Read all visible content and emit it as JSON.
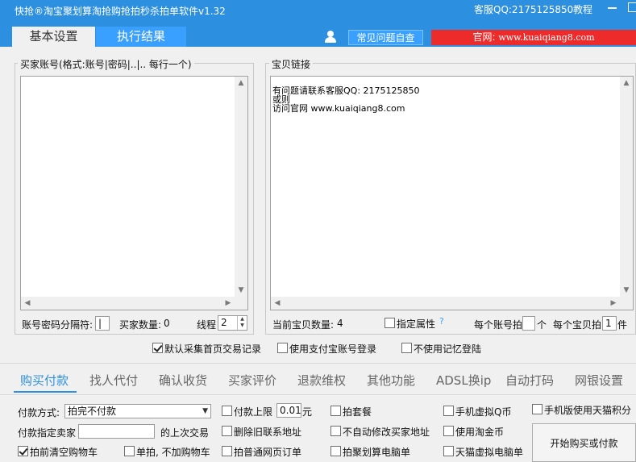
{
  "app": {
    "title": "快抢®淘宝聚划算淘抢购抢拍秒杀拍单软件v1.32",
    "qq": "客服QQ:2175125850",
    "tutorial": "教程"
  },
  "tabs": {
    "basic": "基本设置",
    "result": "执行结果"
  },
  "header": {
    "faq_button": "常见问题自查",
    "site_prefix": "官网: ",
    "site_url": "www.kuaiqiang8.com"
  },
  "buyer_accounts": {
    "group_label": "买家账号(格式:账号|密码|..|.. 每行一个)",
    "content": ""
  },
  "item_links": {
    "group_label": "宝贝链接",
    "lines": [
      "有问题请联系客服QQ: 2175125850",
      "或则",
      "访问官网 www.kuaiqiang8.com"
    ]
  },
  "account_row": {
    "separator_label": "账号密码分隔符:",
    "separator_value": "|",
    "buyer_count_label": "买家数量:",
    "buyer_count": "0",
    "threads_label": "线程",
    "threads_value": "2"
  },
  "item_row": {
    "item_count_label": "当前宝贝数量:",
    "item_count": "4",
    "specify_attr_label": "指定属性",
    "help_icon_text": "?",
    "per_account_label_a": "每个账号拍",
    "per_account_value": "",
    "per_account_label_b": "个",
    "per_item_label_a": "每个宝贝拍",
    "per_item_value": "1",
    "per_item_label_b": "件"
  },
  "options_row": {
    "collect_records": "默认采集首页交易记录",
    "alipay_login": "使用支付宝账号登录",
    "no_remember_login": "不使用记忆登陆"
  },
  "subtabs": [
    "购买付款",
    "找人代付",
    "确认收货",
    "买家评价",
    "退款维权",
    "其他功能",
    "ADSL换ip",
    "自动打码",
    "网银设置"
  ],
  "purchase": {
    "payment_method_label": "付款方式:",
    "payment_method_value": "拍完不付款",
    "pay_limit_label": "付款上限",
    "pay_limit_value": "0.01",
    "pay_limit_unit": "元",
    "package_label": "拍套餐",
    "phone_qcoin_label": "手机虚拟Q币",
    "mobile_tmall_label": "手机版使用天猫积分",
    "designated_seller_label": "付款指定卖家",
    "designated_seller_value": "",
    "last_trade_label": "的上次交易",
    "delete_contact_label": "删除旧联系地址",
    "no_auto_modify_label": "不自动修改买家地址",
    "use_taojinbi_label": "使用淘金币",
    "clear_cart_label": "拍前清空购物车",
    "single_no_cart_label": "单拍, 不加购物车",
    "normal_web_order_label": "拍普通网页订单",
    "juhuasuan_pc_label": "拍聚划算电脑单",
    "tmall_virtual_pc_label": "天猫虚拟电脑单",
    "start_button": "开始购买或付款"
  }
}
